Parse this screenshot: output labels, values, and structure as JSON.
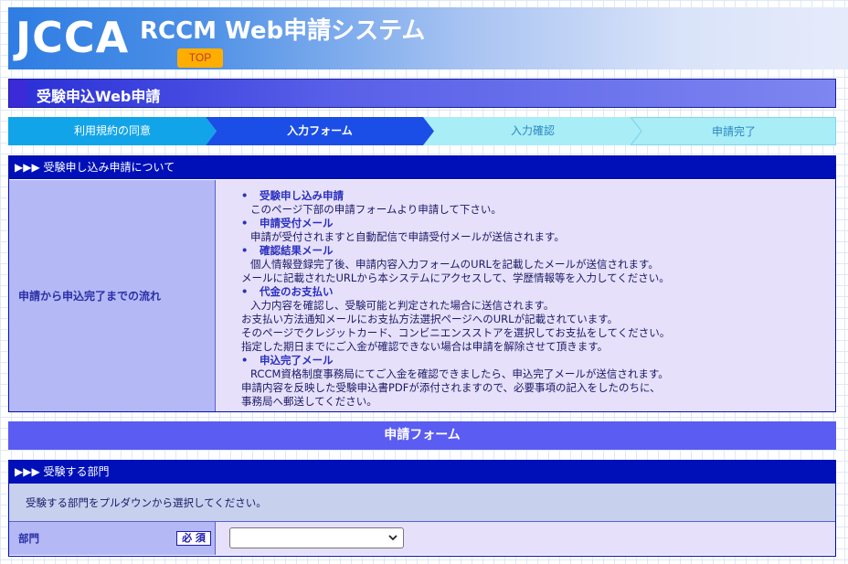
{
  "header": {
    "logo": "JCCA",
    "title": "RCCM Web申請システム",
    "top_button": "TOP"
  },
  "page_title": "受験申込Web申請",
  "steps": [
    {
      "label": "利用規約の同意",
      "state": "done"
    },
    {
      "label": "入力フォーム",
      "state": "current"
    },
    {
      "label": "入力確認",
      "state": "pending"
    },
    {
      "label": "申請完了",
      "state": "pending"
    }
  ],
  "about": {
    "header": "▶▶▶ 受験申し込み申請について",
    "label": "申請から申込完了までの流れ",
    "lines": [
      {
        "t": "受験申し込み申請",
        "k": "h"
      },
      {
        "t": "このページ下部の申請フォームより申請して下さい。",
        "k": "i"
      },
      {
        "t": "申請受付メール",
        "k": "h"
      },
      {
        "t": "申請が受付されますと自動配信で申請受付メールが送信されます。",
        "k": "i"
      },
      {
        "t": "確認結果メール",
        "k": "h"
      },
      {
        "t": "個人情報登録完了後、申請内容入力フォームのURLを記載したメールが送信されます。",
        "k": "i"
      },
      {
        "t": "メールに記載されたURLから本システムにアクセスして、学歴情報等を入力してください。",
        "k": "o"
      },
      {
        "t": "代金のお支払い",
        "k": "h"
      },
      {
        "t": "入力内容を確認し、受験可能と判定された場合に送信されます。",
        "k": "i"
      },
      {
        "t": "お支払い方法通知メールにお支払方法選択ページへのURLが記載されています。",
        "k": "o"
      },
      {
        "t": "そのページでクレジットカード、コンビニエンスストアを選択してお支払をしてください。",
        "k": "o"
      },
      {
        "t": "指定した期日までにご入金が確認できない場合は申請を解除させて頂きます。",
        "k": "o"
      },
      {
        "t": "申込完了メール",
        "k": "h"
      },
      {
        "t": "RCCM資格制度事務局にてご入金を確認できましたら、申込完了メールが送信されます。",
        "k": "i"
      },
      {
        "t": "申請内容を反映した受験申込書PDFが添付されますので、必要事項の記入をしたのちに、",
        "k": "o"
      },
      {
        "t": "事務局へ郵送してください。",
        "k": "o"
      }
    ]
  },
  "form": {
    "title": "申請フォーム",
    "department": {
      "header": "▶▶▶ 受験する部門",
      "info": "受験する部門をプルダウンから選択してください。",
      "label": "部門",
      "required": "必 須",
      "selected": ""
    }
  },
  "colors": {
    "nav_dark": "#0010b8",
    "accent": "#5a5cf2",
    "label_bg": "#b4b8f5",
    "body_bg": "#e6e0fa",
    "top_button": "#ffae00"
  }
}
